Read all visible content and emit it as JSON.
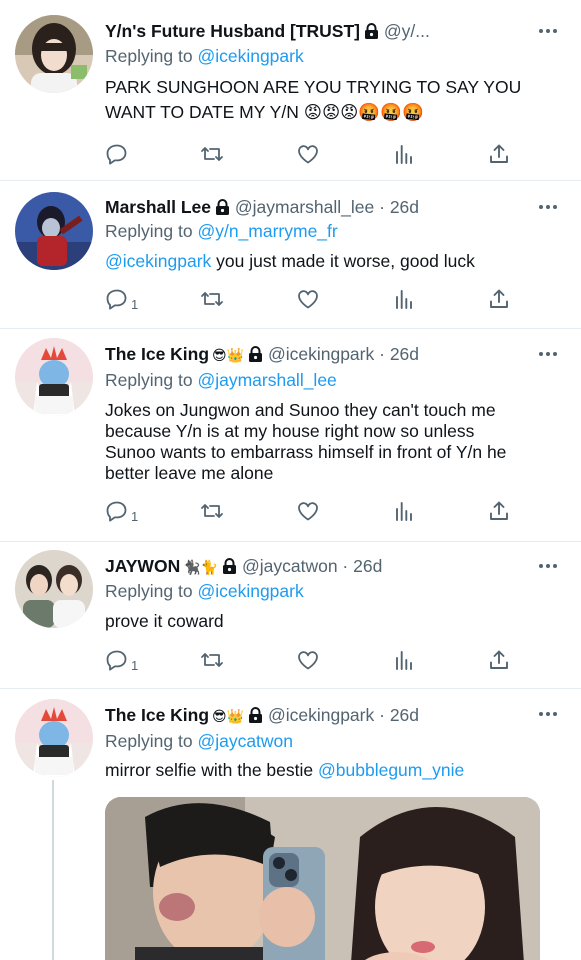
{
  "tweets": [
    {
      "name": "Y/n's Future Husband [TRUST]",
      "handle": "@y/...",
      "time": "",
      "replying_prefix": "Replying to",
      "replying_to": "@icekingpark",
      "text_lines": [
        "PARK SUNGHOON ARE YOU TRYING TO SAY YOU",
        "WANT TO DATE MY Y/N 😡😡😡🤬🤬🤬"
      ],
      "reply_count": ""
    },
    {
      "name": "Marshall Lee",
      "handle": "@jaymarshall_lee",
      "time": "26d",
      "replying_prefix": "Replying to",
      "replying_to": "@y/n_marryme_fr",
      "mention": "@icekingpark",
      "text": " you just made it worse, good luck",
      "reply_count": "1"
    },
    {
      "name": "The Ice King",
      "badges": "😎👑",
      "handle": "@icekingpark",
      "time": "26d",
      "replying_prefix": "Replying to",
      "replying_to": "@jaymarshall_lee",
      "text_lines": [
        "Jokes on Jungwon and Sunoo they can't touch me",
        "because Y/n is at my house right now so unless",
        "Sunoo wants to embarrass himself in front of Y/n he",
        "better leave me alone"
      ],
      "reply_count": "1"
    },
    {
      "name": "JAYWON",
      "badges": "🐈‍⬛🐈",
      "handle": "@jaycatwon",
      "time": "26d",
      "replying_prefix": "Replying to",
      "replying_to": "@icekingpark",
      "text": "prove it coward",
      "reply_count": "1"
    },
    {
      "name": "The Ice King",
      "badges": "😎👑",
      "handle": "@icekingpark",
      "time": "26d",
      "replying_prefix": "Replying to",
      "replying_to": "@jaycatwon",
      "text": "mirror selfie with the bestie ",
      "mention": "@bubblegum_ynie"
    }
  ],
  "separator": " · ",
  "icons": {
    "reply": "reply-icon",
    "retweet": "retweet-icon",
    "like": "heart-icon",
    "views": "analytics-icon",
    "share": "share-icon",
    "more": "more-icon",
    "lock": "lock-icon"
  },
  "colors": {
    "link": "#1d9bf0",
    "secondary": "#536471",
    "text": "#0f1419",
    "thread_line": "#cfd9de"
  }
}
